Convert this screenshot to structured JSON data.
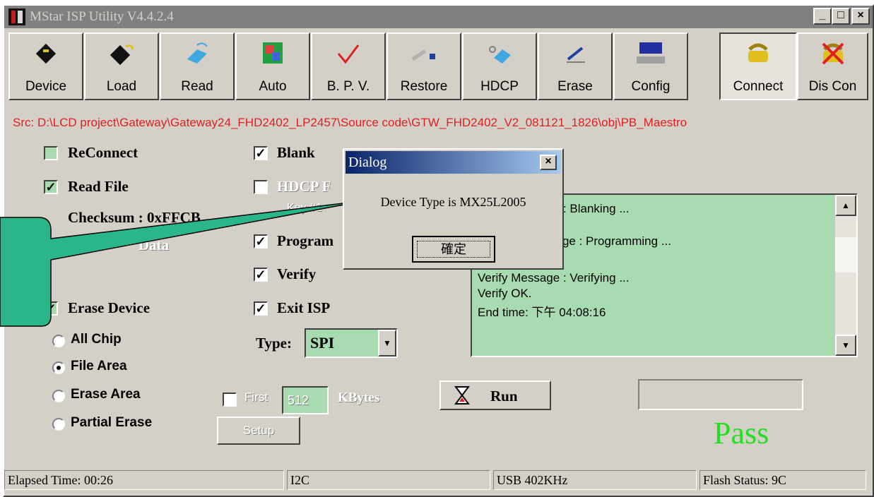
{
  "window": {
    "title": "MStar ISP Utility V4.4.2.4",
    "min_glyph": "_",
    "max_glyph": "□",
    "close_glyph": "×"
  },
  "toolbar": {
    "buttons": [
      {
        "label": "Device",
        "icon": "chip-icon"
      },
      {
        "label": "Load",
        "icon": "load-chip-icon"
      },
      {
        "label": "Read",
        "icon": "read-icon"
      },
      {
        "label": "Auto",
        "icon": "auto-icon"
      },
      {
        "label": "B. P. V.",
        "icon": "check-icon"
      },
      {
        "label": "Restore",
        "icon": "restore-icon"
      },
      {
        "label": "HDCP",
        "icon": "hdcp-icon"
      },
      {
        "label": "Erase",
        "icon": "erase-icon"
      },
      {
        "label": "Config",
        "icon": "monitor-icon"
      },
      {
        "label": "Connect",
        "icon": "phone-icon",
        "pressed": true
      },
      {
        "label": "Dis Con",
        "icon": "phone-disconnect-icon"
      }
    ]
  },
  "source_path": "Src: D:\\LCD project\\Gateway\\Gateway24_FHD2402_LP2457\\Source code\\GTW_FHD2402_V2_081121_1826\\obj\\PB_Maestro",
  "options": {
    "reconnect": {
      "label": "ReConnect",
      "checked": false
    },
    "read_file": {
      "label": "Read File",
      "checked": true
    },
    "checksum": "Checksum : 0xFFCB",
    "data_label": "Data",
    "erase_device": {
      "label": "Erase Device",
      "checked": true
    },
    "blank": {
      "label": "Blank",
      "checked": true
    },
    "hdcp": {
      "label": "HDCP F",
      "checked": false
    },
    "key_label": "Key #1",
    "program": {
      "label": "Program",
      "checked": true
    },
    "verify": {
      "label": "Verify",
      "checked": true
    },
    "exit_isp": {
      "label": "Exit ISP",
      "checked": true
    },
    "check_glyph": "✓",
    "type_label": "Type:",
    "type_value": "SPI"
  },
  "erase_modes": {
    "all_chip": "All Chip",
    "file_area": "File Area",
    "erase_area": "Erase Area",
    "partial_erase": "Partial Erase",
    "selected": "File Area"
  },
  "first_kbytes": {
    "label": "First",
    "value": "512",
    "unit": "KBytes",
    "checked": false
  },
  "setup_label": "Setup",
  "run_label": "Run",
  "log": {
    "lines": [
      "Blank Message : Blanking ...",
      "Program Message : Programming ...",
      "Verify Message : Verifying ...",
      "Verify OK.",
      "End time: 下午 04:08:16"
    ]
  },
  "result_text": "Pass",
  "status_bar": {
    "elapsed": "Elapsed Time: 00:26",
    "interface": "I2C",
    "usb": "USB  402KHz",
    "flash": "Flash Status: 9C"
  },
  "dialog": {
    "title": "Dialog",
    "message": "Device Type is MX25L2005",
    "ok_label": "確定",
    "close_glyph": "×"
  },
  "colors": {
    "green_field": "#a8dcb0",
    "pass": "#20e020",
    "src_text": "#e02020",
    "callout": "#2ab58a"
  }
}
